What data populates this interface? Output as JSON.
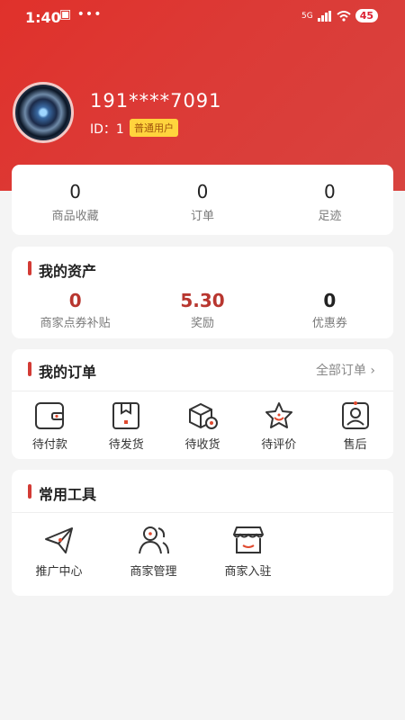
{
  "status": {
    "time": "1:40",
    "dots": "▣ •••",
    "net": "5G",
    "battery": "45"
  },
  "profile": {
    "phone": "191****7091",
    "id_text": "ID：1",
    "badge": "普通用户"
  },
  "stats": [
    {
      "value": "0",
      "label": "商品收藏"
    },
    {
      "value": "0",
      "label": "订单"
    },
    {
      "value": "0",
      "label": "足迹"
    }
  ],
  "assets": {
    "title": "我的资产",
    "items": [
      {
        "value": "0",
        "label": "商家点券补贴"
      },
      {
        "value": "5.30",
        "label": "奖励"
      },
      {
        "value": "0",
        "label": "优惠券"
      }
    ]
  },
  "orders": {
    "title": "我的订单",
    "all_link": "全部订单",
    "items": [
      {
        "label": "待付款",
        "icon": "wallet-icon"
      },
      {
        "label": "待发货",
        "icon": "package-icon"
      },
      {
        "label": "待收货",
        "icon": "box-icon"
      },
      {
        "label": "待评价",
        "icon": "star-icon"
      },
      {
        "label": "售后",
        "icon": "service-icon"
      }
    ]
  },
  "tools": {
    "title": "常用工具",
    "items": [
      {
        "label": "推广中心",
        "icon": "paper-plane-icon"
      },
      {
        "label": "商家管理",
        "icon": "users-icon"
      },
      {
        "label": "商家入驻",
        "icon": "store-icon"
      }
    ]
  },
  "colors": {
    "accent": "#d33b35",
    "badge": "#ffd43d"
  }
}
